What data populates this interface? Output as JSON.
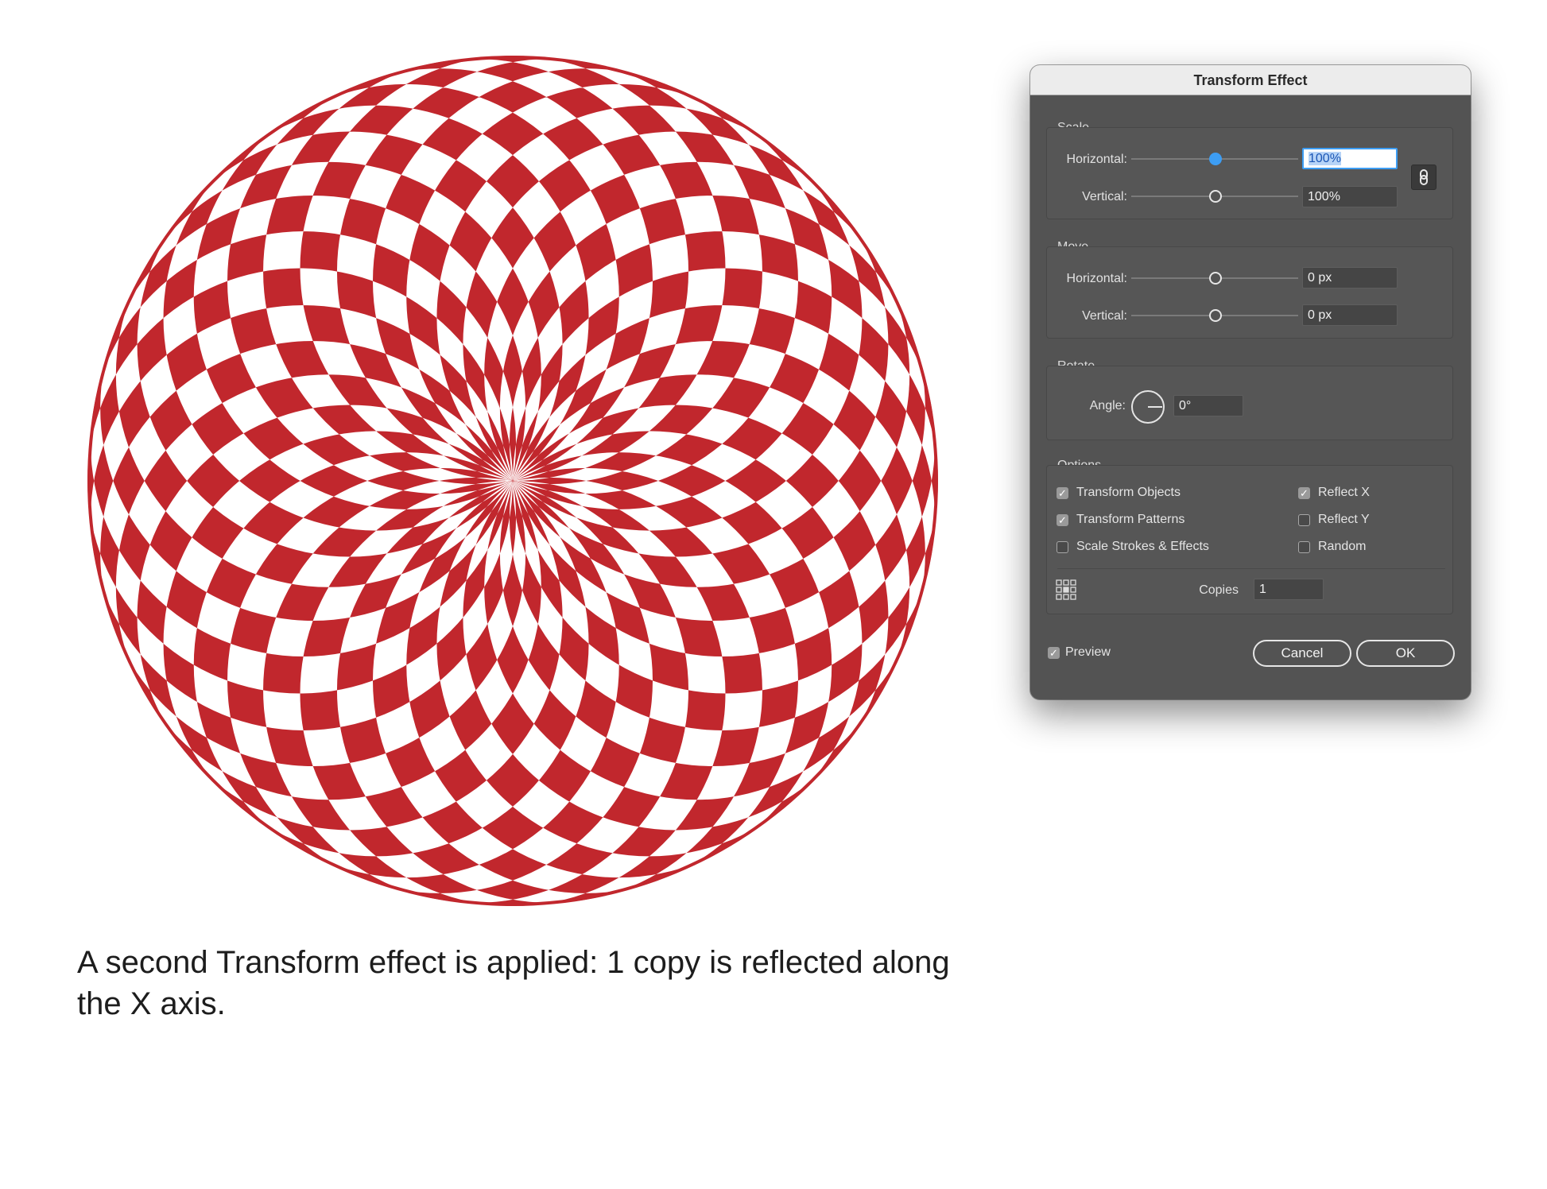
{
  "artwork": {
    "fill_color": "#c1272d",
    "background_color": "#ffffff",
    "petals": 36
  },
  "caption": {
    "line1": "A second Transform effect is applied: 1 copy is reflected along",
    "line2": "the X axis."
  },
  "dialog": {
    "title": "Transform Effect",
    "scale": {
      "title": "Scale",
      "horizontal_label": "Horizontal:",
      "horizontal_value": "100%",
      "vertical_label": "Vertical:",
      "vertical_value": "100%",
      "link_icon": "link-icon"
    },
    "move": {
      "title": "Move",
      "horizontal_label": "Horizontal:",
      "horizontal_value": "0 px",
      "vertical_label": "Vertical:",
      "vertical_value": "0 px"
    },
    "rotate": {
      "title": "Rotate",
      "angle_label": "Angle:",
      "angle_value": "0°",
      "dial_icon": "angle-dial-icon"
    },
    "options": {
      "title": "Options",
      "transform_objects": "Transform Objects",
      "transform_patterns": "Transform Patterns",
      "scale_strokes": "Scale Strokes & Effects",
      "reflect_x": "Reflect X",
      "reflect_y": "Reflect Y",
      "random": "Random",
      "copies_label": "Copies",
      "copies_value": "1",
      "reference_point_icon": "reference-point-icon"
    },
    "preview_label": "Preview",
    "cancel_label": "Cancel",
    "ok_label": "OK",
    "accent_color": "#3d9df3"
  }
}
